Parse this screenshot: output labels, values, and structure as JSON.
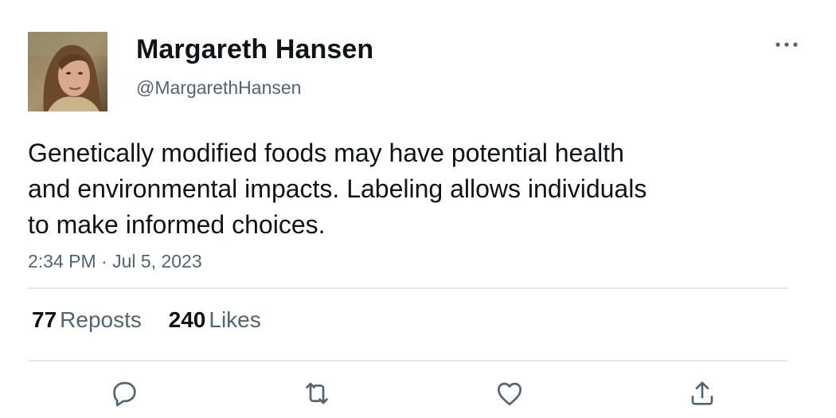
{
  "author": {
    "display_name": "Margareth Hansen",
    "handle": "@MargarethHansen",
    "avatar_icon": "profile-photo"
  },
  "tweet": {
    "text_lines": [
      "Genetically modified foods may have potential health",
      "and environmental impacts. Labeling allows individuals",
      "to make informed choices."
    ],
    "timestamp": "2:34 PM · Jul 5, 2023"
  },
  "stats": {
    "reposts_count": "77",
    "reposts_label": "Reposts",
    "likes_count": "240",
    "likes_label": "Likes"
  },
  "actions": [
    "reply-icon",
    "repost-icon",
    "like-icon",
    "share-icon"
  ],
  "colors": {
    "text_primary": "#0f1419",
    "text_secondary": "#536471",
    "divider": "#e6e9ea"
  }
}
